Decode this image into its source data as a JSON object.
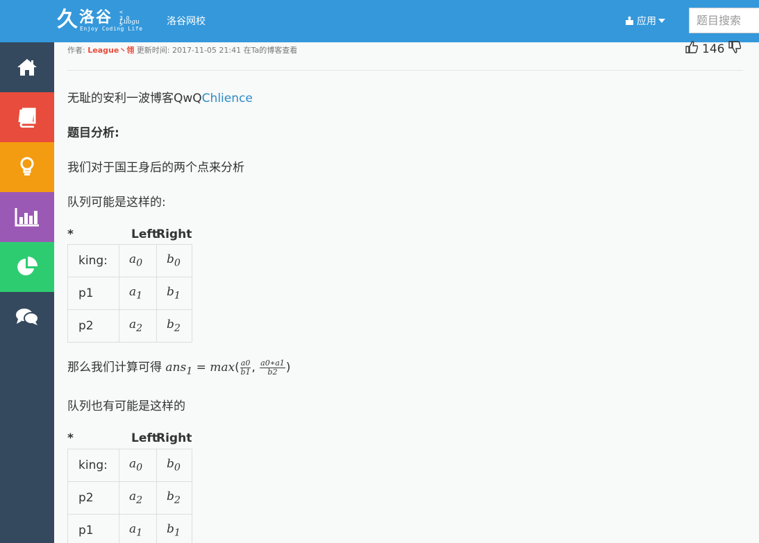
{
  "header": {
    "logo_mark": "久",
    "logo_cn": "洛谷",
    "logo_version": "< 3.0 >",
    "logo_en": "Luogu",
    "logo_slogan": "Enjoy Coding Life",
    "school_link": "洛谷网校",
    "apps_label": "应用",
    "search_placeholder": "题目搜索"
  },
  "sidebar": {
    "items": [
      {
        "icon": "home-icon",
        "color": "#34495e"
      },
      {
        "icon": "book-icon",
        "color": "#e74c3c"
      },
      {
        "icon": "lightbulb-icon",
        "color": "#f39c12"
      },
      {
        "icon": "bar-chart-icon",
        "color": "#9b59b6"
      },
      {
        "icon": "pie-chart-icon",
        "color": "#2ecc71"
      },
      {
        "icon": "chat-icon",
        "color": "#34495e"
      }
    ]
  },
  "post": {
    "author_prefix": "作者:",
    "author": "League丶翎",
    "updated_label": "更新时间:",
    "updated_time": "2017-11-05 21:41",
    "blog_link": "在Ta的博客查看",
    "likes": "146"
  },
  "body": {
    "intro": "无耻的安利一波博客QwQ",
    "intro_link": "Chlience",
    "analysis_heading": "题目分析:",
    "para1": "我们对于国王身后的两个点来分析",
    "para2": "队列可能是这样的:",
    "para3_prefix": "那么我们计算可得",
    "para4": "队列也有可能是这样的",
    "table_headers": [
      "*",
      "Left",
      "Right"
    ],
    "table1": [
      {
        "label": "king:",
        "left": "a",
        "left_sub": "0",
        "right": "b",
        "right_sub": "0"
      },
      {
        "label": "p1",
        "left": "a",
        "left_sub": "1",
        "right": "b",
        "right_sub": "1"
      },
      {
        "label": "p2",
        "left": "a",
        "left_sub": "2",
        "right": "b",
        "right_sub": "2"
      }
    ],
    "table2": [
      {
        "label": "king:",
        "left": "a",
        "left_sub": "0",
        "right": "b",
        "right_sub": "0"
      },
      {
        "label": "p2",
        "left": "a",
        "left_sub": "2",
        "right": "b",
        "right_sub": "2"
      },
      {
        "label": "p1",
        "left": "a",
        "left_sub": "1",
        "right": "b",
        "right_sub": "1"
      }
    ],
    "formula": {
      "lhs": "ans",
      "lhs_sub": "1",
      "eq": "=",
      "fn": "max",
      "frac1_num": "a0",
      "frac1_den": "b1",
      "frac2_num": "a0∗a1",
      "frac2_den": "b2"
    }
  }
}
